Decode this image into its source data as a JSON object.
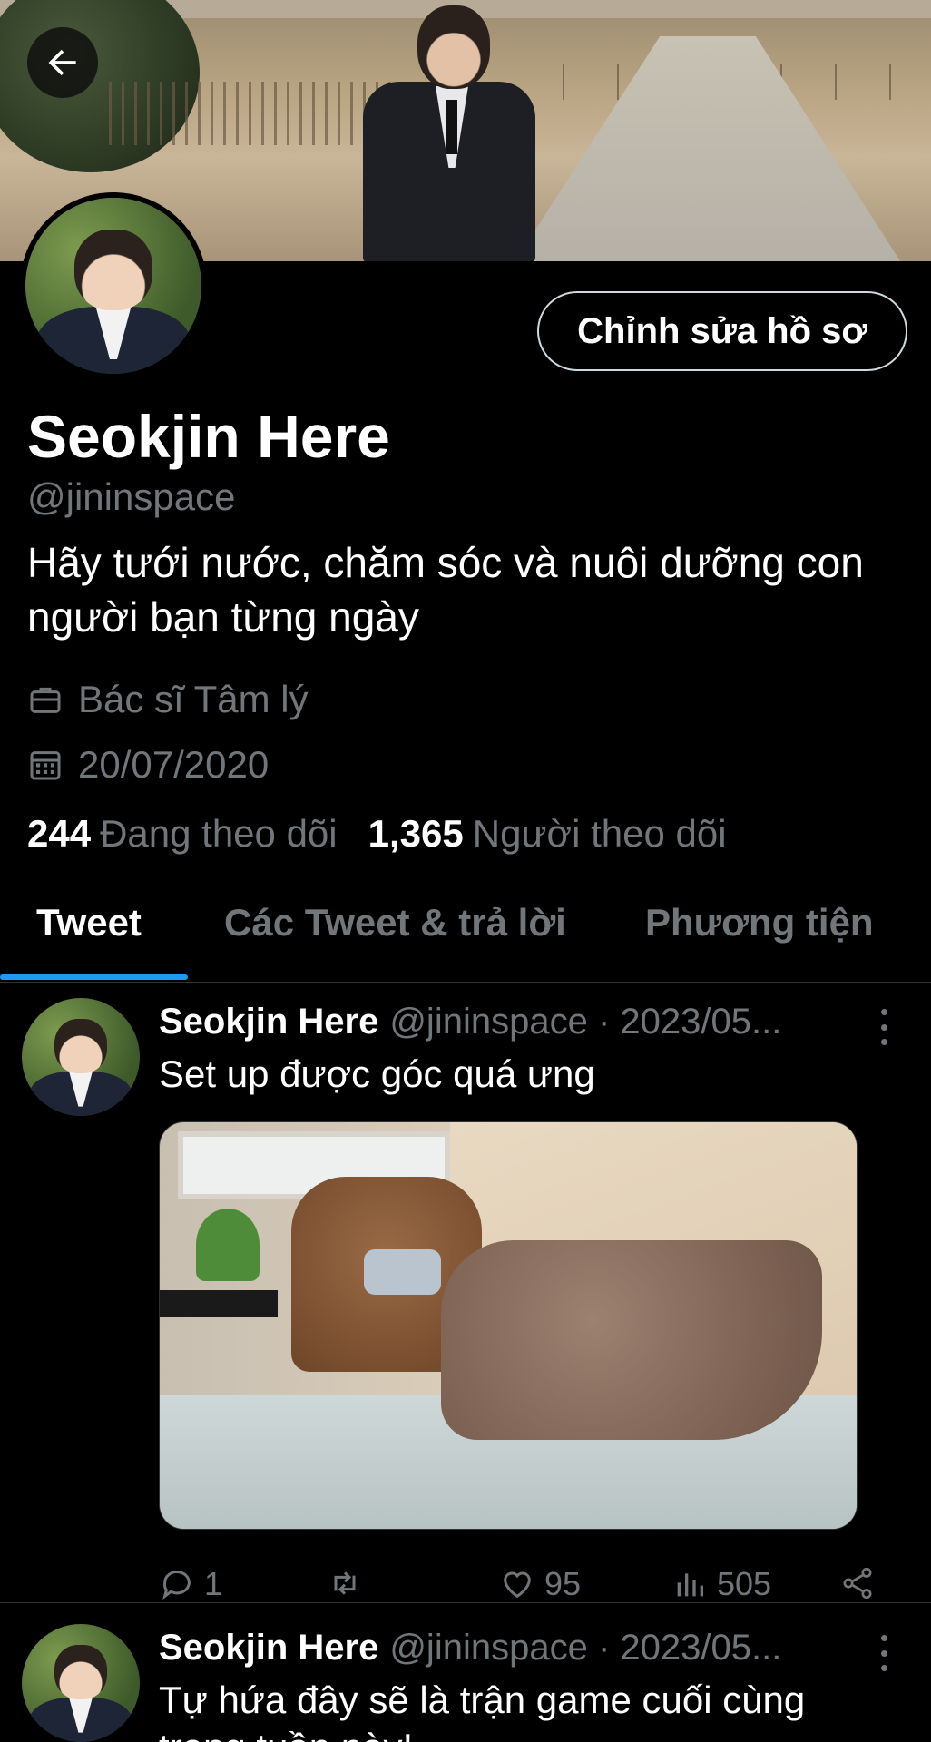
{
  "profile": {
    "display_name": "Seokjin Here",
    "handle": "@jininspace",
    "bio": "Hãy tưới nước, chăm sóc và nuôi dưỡng con người bạn từng ngày",
    "occupation": "Bác sĩ Tâm lý",
    "joined": "20/07/2020",
    "following_count": "244",
    "following_label": "Đang theo dõi",
    "followers_count": "1,365",
    "followers_label": "Người theo dõi",
    "edit_button": "Chỉnh sửa hồ sơ"
  },
  "tabs": [
    {
      "label": "Tweet",
      "active": true
    },
    {
      "label": "Các Tweet & trả lời",
      "active": false
    },
    {
      "label": "Phương tiện",
      "active": false
    }
  ],
  "tweets": [
    {
      "name": "Seokjin Here",
      "handle_date": "@jininspace · 2023/05...",
      "text": "Set up được góc quá ưng",
      "replies": "1",
      "retweets": "",
      "likes": "95",
      "views": "505"
    },
    {
      "name": "Seokjin Here",
      "handle_date": "@jininspace · 2023/05...",
      "text": "Tự hứa đây sẽ là trận game cuối cùng trong tuần này!"
    }
  ],
  "icons": {
    "back": "arrow-left-icon",
    "occupation": "briefcase-icon",
    "joined": "calendar-icon",
    "reply": "reply-icon",
    "retweet": "retweet-icon",
    "like": "heart-icon",
    "views": "views-icon",
    "share": "share-icon"
  },
  "colors": {
    "background": "#000000",
    "accent": "#1d9bf0",
    "muted": "#71767b",
    "text": "#ffffff"
  }
}
